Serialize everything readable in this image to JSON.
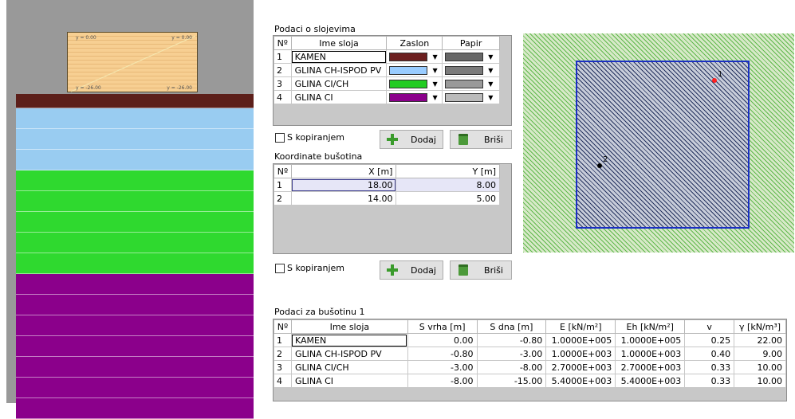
{
  "profile": {
    "foundation_tags": {
      "top_left": "y = 0.00",
      "top_right": "y = 0.00",
      "bottom_left": "y = -26.00",
      "bottom_right": "y = -26.00"
    },
    "soil_layers": [
      {
        "color": "#5c1f1a",
        "stripes": 1
      },
      {
        "color": "#99ccf1",
        "stripes": 3
      },
      {
        "color": "#2fd92f",
        "stripes": 5
      },
      {
        "color": "#8b008b",
        "stripes": 7
      }
    ]
  },
  "layers_section": {
    "title": "Podaci o slojevima",
    "headers": [
      "Nº",
      "Ime sloja",
      "Zaslon",
      "Papir"
    ],
    "rows": [
      {
        "n": "1",
        "name": "KAMEN",
        "screen": "#6b1e1e",
        "paper": "#666666"
      },
      {
        "n": "2",
        "name": "GLINA CH-ISPOD PV",
        "screen": "#99ccff",
        "paper": "#7a7a7a"
      },
      {
        "n": "3",
        "name": "GLINA CI/CH",
        "screen": "#22cc22",
        "paper": "#999999"
      },
      {
        "n": "4",
        "name": "GLINA CI",
        "screen": "#8b008b",
        "paper": "#bbbbbb"
      }
    ],
    "copy_label": "S kopiranjem",
    "add_label": "Dodaj",
    "delete_label": "Briši"
  },
  "boreholes_section": {
    "title": "Koordinate bušotina",
    "headers": [
      "Nº",
      "X [m]",
      "Y [m]"
    ],
    "rows": [
      {
        "n": "1",
        "x": "18.00",
        "y": "8.00"
      },
      {
        "n": "2",
        "x": "14.00",
        "y": "5.00"
      }
    ],
    "copy_label": "S kopiranjem",
    "add_label": "Dodaj",
    "delete_label": "Briši"
  },
  "plan": {
    "point1_label": "1",
    "point2_label": "2"
  },
  "borehole_data": {
    "title": "Podaci za bušotinu 1",
    "headers": [
      "Nº",
      "Ime sloja",
      "S vrha [m]",
      "S dna [m]",
      "E [kN/m²]",
      "Eh [kN/m²]",
      "v",
      "γ [kN/m³]"
    ],
    "rows": [
      {
        "n": "1",
        "name": "KAMEN",
        "top": "0.00",
        "bottom": "-0.80",
        "e": "1.0000E+005",
        "eh": "1.0000E+005",
        "v": "0.25",
        "g": "22.00"
      },
      {
        "n": "2",
        "name": "GLINA CH-ISPOD PV",
        "top": "-0.80",
        "bottom": "-3.00",
        "e": "1.0000E+003",
        "eh": "1.0000E+003",
        "v": "0.40",
        "g": "9.00"
      },
      {
        "n": "3",
        "name": "GLINA CI/CH",
        "top": "-3.00",
        "bottom": "-8.00",
        "e": "2.7000E+003",
        "eh": "2.7000E+003",
        "v": "0.33",
        "g": "10.00"
      },
      {
        "n": "4",
        "name": "GLINA CI",
        "top": "-8.00",
        "bottom": "-15.00",
        "e": "5.4000E+003",
        "eh": "5.4000E+003",
        "v": "0.33",
        "g": "10.00"
      }
    ]
  }
}
